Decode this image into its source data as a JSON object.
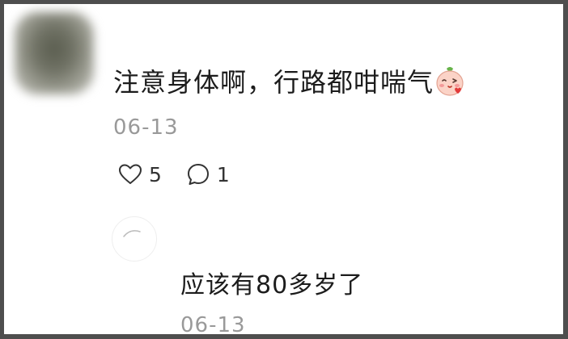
{
  "comment": {
    "text": "注意身体啊，行路都咁喘气",
    "emoji": "blushing-face-emoji",
    "date": "06-13",
    "likes": "5",
    "replies_count": "1"
  },
  "reply": {
    "text": "应该有80多岁了",
    "date": "06-13"
  },
  "icons": {
    "like": "heart-outline-icon",
    "comment": "speech-bubble-icon"
  },
  "colors": {
    "text": "#1c1c1c",
    "meta": "#999999",
    "frame": "#4e4e4e"
  }
}
